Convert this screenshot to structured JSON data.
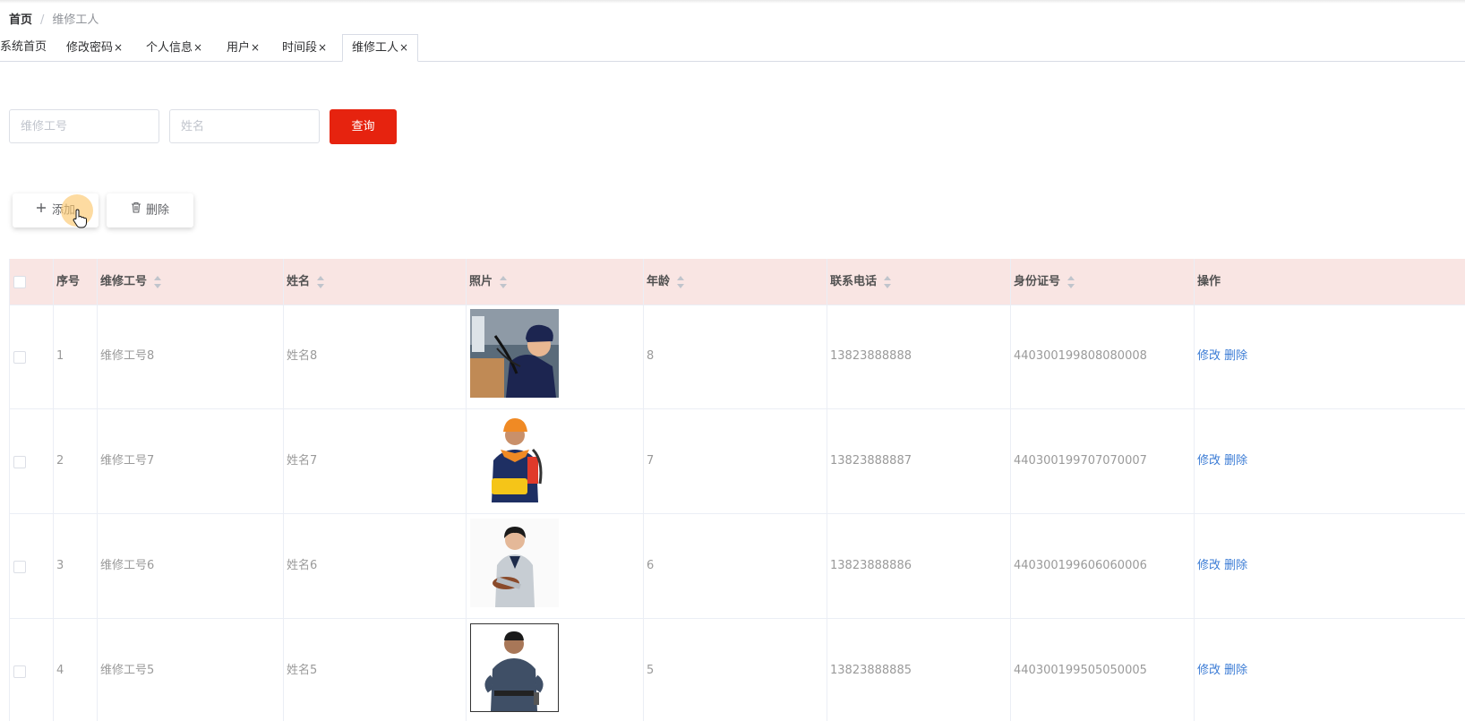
{
  "breadcrumb": {
    "home": "首页",
    "separator": "/",
    "current": "维修工人"
  },
  "tabs": [
    {
      "label": "系统首页",
      "closable": false,
      "active": false
    },
    {
      "label": "修改密码",
      "closable": true,
      "active": false
    },
    {
      "label": "个人信息",
      "closable": true,
      "active": false
    },
    {
      "label": "用户",
      "closable": true,
      "active": false
    },
    {
      "label": "时间段",
      "closable": true,
      "active": false
    },
    {
      "label": "维修工人",
      "closable": true,
      "active": true
    }
  ],
  "close_glyph": "×",
  "search": {
    "worker_no_placeholder": "维修工号",
    "name_placeholder": "姓名",
    "query_label": "查询"
  },
  "actions": {
    "add_label": "添加",
    "delete_label": "删除"
  },
  "table": {
    "headers": {
      "index": "序号",
      "worker_no": "维修工号",
      "name": "姓名",
      "photo": "照片",
      "age": "年龄",
      "phone": "联系电话",
      "id_card": "身份证号",
      "operation": "操作"
    },
    "rows": [
      {
        "index": "1",
        "worker_no": "维修工号8",
        "name": "姓名8",
        "age": "8",
        "phone": "13823888888",
        "id_card": "440300199808080008",
        "edit": "修改",
        "delete": "删除"
      },
      {
        "index": "2",
        "worker_no": "维修工号7",
        "name": "姓名7",
        "age": "7",
        "phone": "13823888887",
        "id_card": "440300199707070007",
        "edit": "修改",
        "delete": "删除"
      },
      {
        "index": "3",
        "worker_no": "维修工号6",
        "name": "姓名6",
        "age": "6",
        "phone": "13823888886",
        "id_card": "440300199606060006",
        "edit": "修改",
        "delete": "删除"
      },
      {
        "index": "4",
        "worker_no": "维修工号5",
        "name": "姓名5",
        "age": "5",
        "phone": "13823888885",
        "id_card": "440300199505050005",
        "edit": "修改",
        "delete": "删除"
      }
    ]
  },
  "colors": {
    "primary_red": "#e6230f",
    "header_bg": "#f9e5e3",
    "link_blue": "#3a7bd5"
  },
  "icons": {
    "add": "plus-icon",
    "delete": "trash-icon",
    "cursor": "hand-pointer-icon",
    "sort": "sort-caret-icon"
  }
}
